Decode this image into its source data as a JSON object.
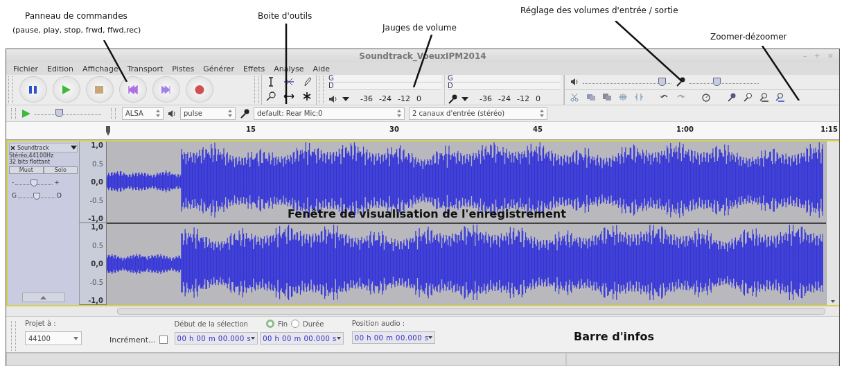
{
  "annotations": [
    {
      "text": "Panneau de commandes"
    },
    {
      "text": "(pause, play, stop, frwd, ffwd,rec)"
    },
    {
      "text": "Boite d'outils"
    },
    {
      "text": "Jauges de volume"
    },
    {
      "text": "Réglage des volumes d'entrée / sortie"
    },
    {
      "text": "Zoomer-dézoomer"
    },
    {
      "text": "Fenêtre de visualisation de l'enregistrement"
    },
    {
      "text": "Barre d'infos"
    }
  ],
  "window": {
    "title": "Soundtrack_VoeuxIPM2014",
    "controls": [
      "–",
      "+",
      "×"
    ]
  },
  "menu": [
    "Fichier",
    "Edition",
    "Affichage",
    "Transport",
    "Pistes",
    "Générer",
    "Effets",
    "Analyse",
    "Aide"
  ],
  "meters": [
    {
      "kind": "playback",
      "channels": [
        "G",
        "D"
      ],
      "scale": [
        "-36",
        "-24",
        "-12",
        "0"
      ]
    },
    {
      "kind": "recording",
      "channels": [
        "G",
        "D"
      ],
      "scale": [
        "-36",
        "-24",
        "-12",
        "0"
      ]
    }
  ],
  "mixer": {
    "output": {
      "level": 0.92
    },
    "input": {
      "level": 0.38
    }
  },
  "play_at_speed": {
    "level": 0.35
  },
  "device_bar": {
    "host": "ALSA",
    "output": "pulse",
    "input": "default: Rear Mic:0",
    "channels": "2 canaux d'entrée (stéréo)"
  },
  "ruler": [
    "15",
    "30",
    "45",
    "1:00",
    "1:15"
  ],
  "track": {
    "name": "Soundtrack",
    "info": [
      "Stéréo,44100Hz",
      "32 bits flottant"
    ],
    "buttons": [
      "Muet",
      "Solo"
    ],
    "gain": {
      "level": 0.5,
      "min": "-",
      "max": "+"
    },
    "pan": {
      "level": 0.5,
      "left": "G",
      "right": "D"
    },
    "scales": [
      [
        "1,0",
        "0.5",
        "0,0",
        "-0.5",
        "-1,0"
      ],
      [
        "1,0",
        "0.5",
        "0,0",
        "-0.5",
        "-1,0"
      ]
    ]
  },
  "selection_bar": {
    "project_rate_label": "Projet à :",
    "project_rate": "44100",
    "snap_label": "Incrément...",
    "snap_checked": false,
    "selection_label": "Début de la sélection",
    "options": [
      {
        "label": "Fin",
        "selected": true
      },
      {
        "label": "Durée",
        "selected": false
      }
    ],
    "times": [
      "00 h 00 m 00.000 s",
      "00 h 00 m 00.000 s"
    ],
    "audio_position_label": "Position audio :",
    "audio_position": "00 h 00 m 00.000 s"
  }
}
